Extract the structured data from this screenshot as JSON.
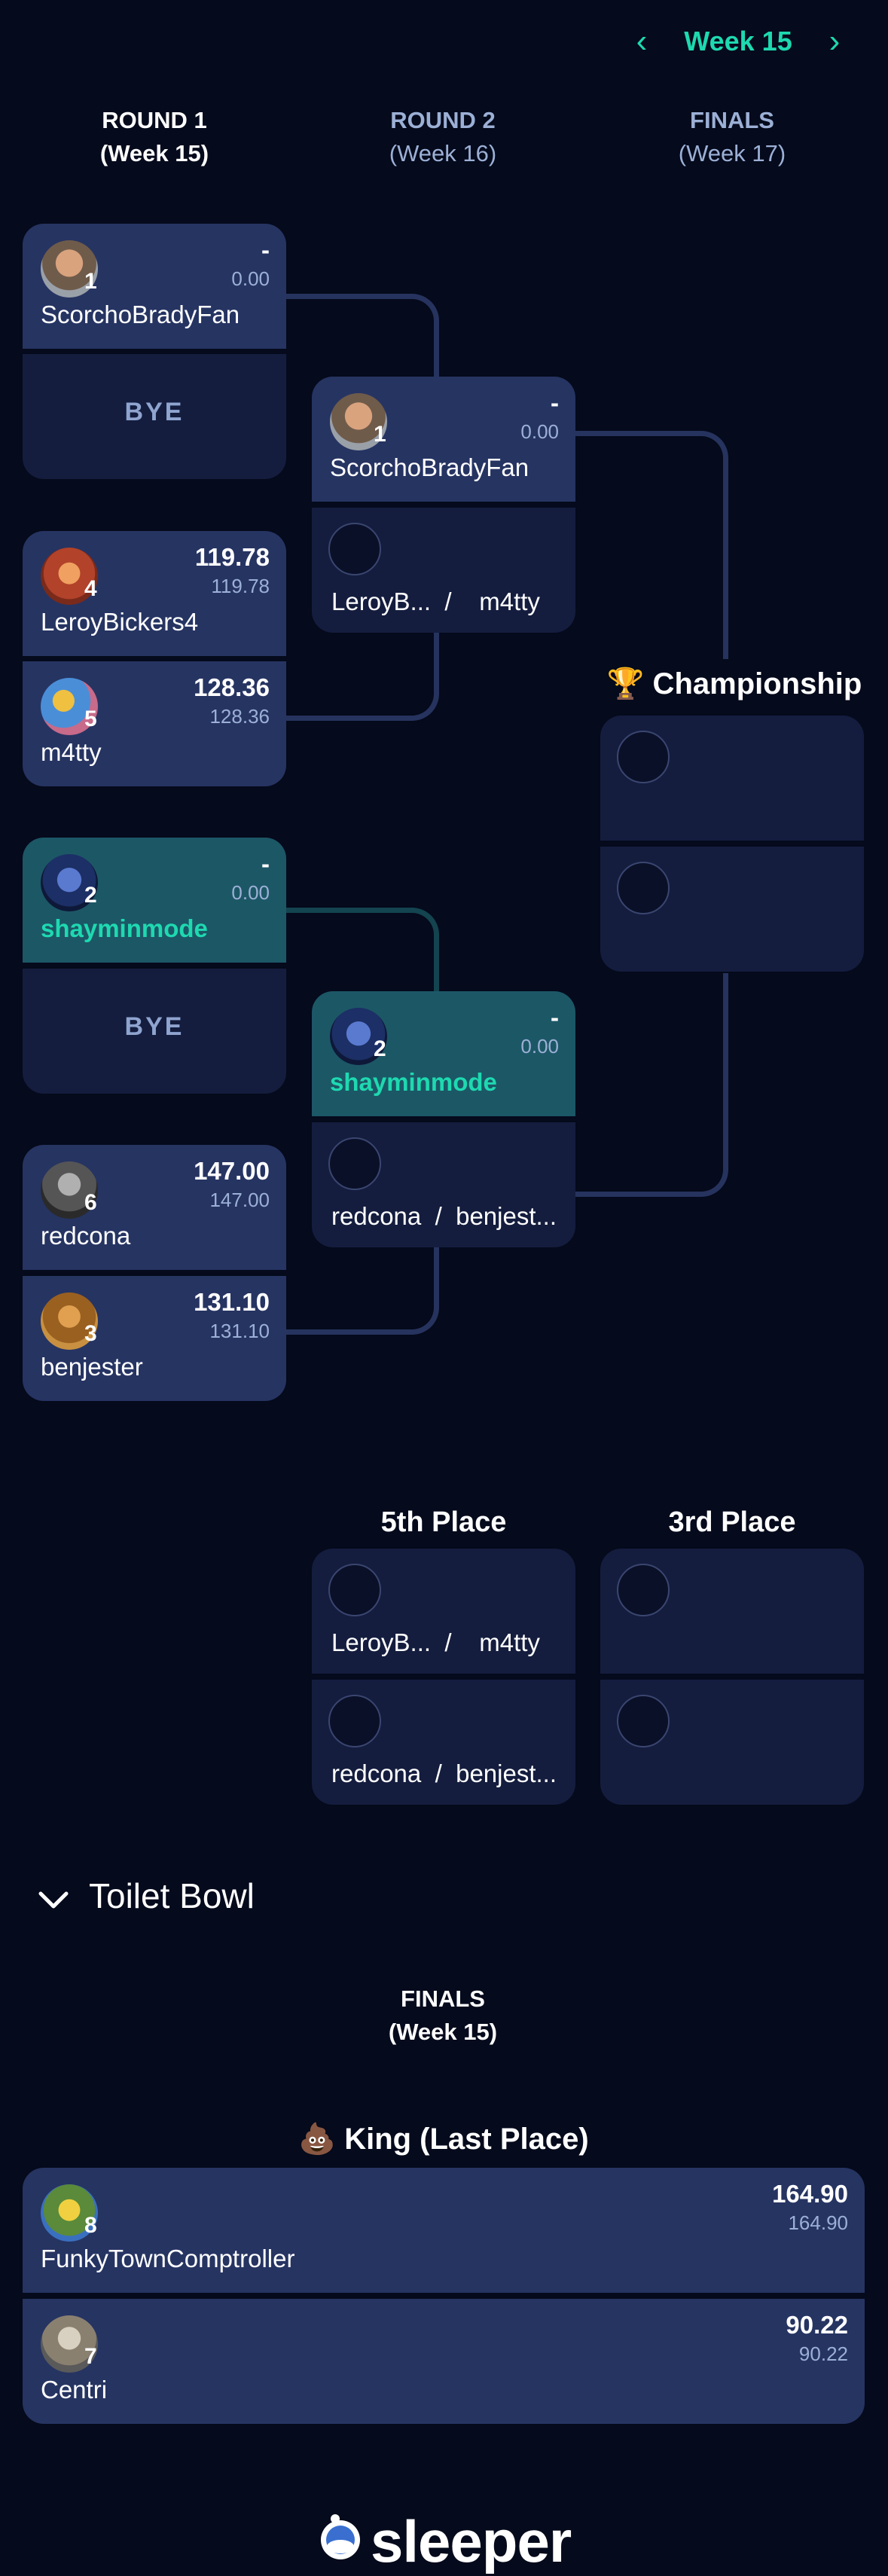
{
  "nav": {
    "week_label": "Week 15",
    "prev": "‹",
    "next": "›"
  },
  "rounds": [
    {
      "title": "ROUND 1",
      "week": "(Week 15)"
    },
    {
      "title": "ROUND 2",
      "week": "(Week 16)"
    },
    {
      "title": "FINALS",
      "week": "(Week 17)"
    }
  ],
  "r1": {
    "m1": {
      "team": {
        "name": "ScorchoBradyFan",
        "seed": "1",
        "score": "-",
        "proj": "0.00"
      },
      "bye": "BYE"
    },
    "m2": {
      "a": {
        "name": "LeroyBickers4",
        "seed": "4",
        "score": "119.78",
        "proj": "119.78"
      },
      "b": {
        "name": "m4tty",
        "seed": "5",
        "score": "128.36",
        "proj": "128.36"
      }
    },
    "m3": {
      "team": {
        "name": "shayminmode",
        "seed": "2",
        "score": "-",
        "proj": "0.00"
      },
      "bye": "BYE"
    },
    "m4": {
      "a": {
        "name": "redcona",
        "seed": "6",
        "score": "147.00",
        "proj": "147.00"
      },
      "b": {
        "name": "benjester",
        "seed": "3",
        "score": "131.10",
        "proj": "131.10"
      }
    }
  },
  "r2": {
    "m1": {
      "team": {
        "name": "ScorchoBradyFan",
        "seed": "1",
        "score": "-",
        "proj": "0.00"
      },
      "pending": "LeroyB...  /    m4tty"
    },
    "m2": {
      "team": {
        "name": "shayminmode",
        "seed": "2",
        "score": "-",
        "proj": "0.00"
      },
      "pending": "redcona  /  benjest..."
    }
  },
  "championship": {
    "title": "🏆 Championship"
  },
  "fifth": {
    "title": "5th Place",
    "slot1": "LeroyB...  /    m4tty",
    "slot2": "redcona  /  benjest..."
  },
  "third": {
    "title": "3rd Place"
  },
  "toilet": {
    "header": "Toilet Bowl",
    "round_title": "FINALS",
    "round_week": "(Week 15)",
    "king_title": "💩 King (Last Place)",
    "a": {
      "name": "FunkyTownComptroller",
      "seed": "8",
      "score": "164.90",
      "proj": "164.90"
    },
    "b": {
      "name": "Centri",
      "seed": "7",
      "score": "90.22",
      "proj": "90.22"
    }
  },
  "footer": {
    "logo": "sleeper"
  },
  "colors": {
    "accent": "#1ed9b0",
    "background": "#050a1c",
    "card": "#263462",
    "highlight": "#1c5766"
  }
}
